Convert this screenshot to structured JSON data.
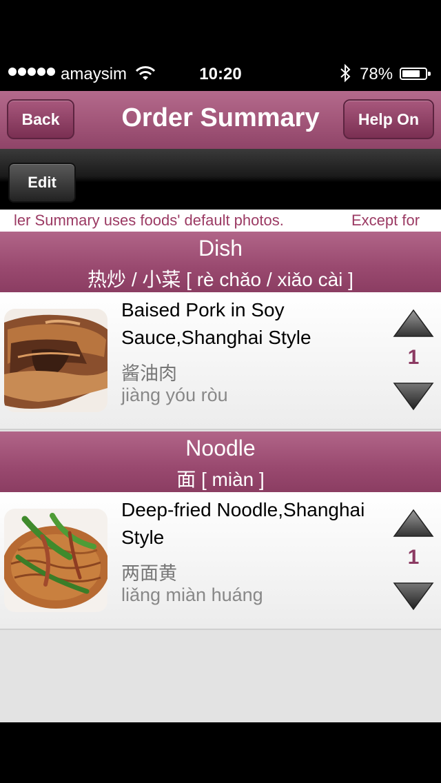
{
  "status_bar": {
    "carrier": "amaysim",
    "time": "10:20",
    "battery": "78%",
    "battery_level": 0.78
  },
  "nav": {
    "back_label": "Back",
    "title": "Order Summary",
    "help_label": "Help On"
  },
  "toolbar": {
    "edit_label": "Edit"
  },
  "marquee": {
    "text_1": "ler Summary uses foods' default photos.",
    "text_2": "Except for"
  },
  "sections": [
    {
      "title": "Dish",
      "subtitle": "热炒 / 小菜 [ rè chǎo / xiǎo cài ]",
      "items": [
        {
          "name": "Baised Pork in Soy Sauce,Shanghai Style",
          "chinese": "酱油肉",
          "pinyin": "jiàng yóu ròu",
          "quantity": "1"
        }
      ]
    },
    {
      "title": "Noodle",
      "subtitle": "面 [ miàn ]",
      "items": [
        {
          "name": "Deep-fried Noodle,Shanghai Style",
          "chinese": "两面黄",
          "pinyin": "liǎng miàn huáng",
          "quantity": "1"
        }
      ]
    }
  ]
}
